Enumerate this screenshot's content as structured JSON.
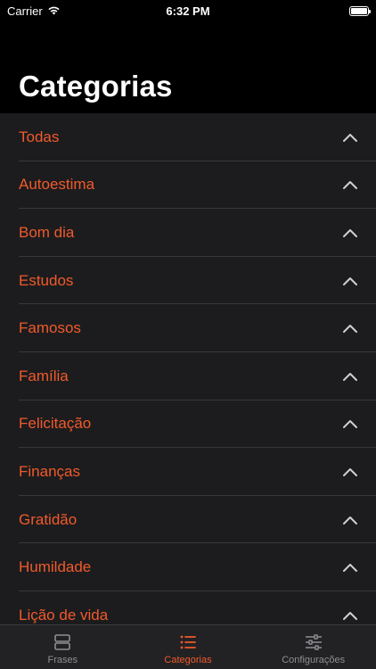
{
  "status": {
    "carrier": "Carrier",
    "time": "6:32 PM"
  },
  "page": {
    "title": "Categorias"
  },
  "categories": [
    {
      "label": "Todas"
    },
    {
      "label": "Autoestima"
    },
    {
      "label": "Bom dia"
    },
    {
      "label": "Estudos"
    },
    {
      "label": "Famosos"
    },
    {
      "label": "Família"
    },
    {
      "label": "Felicitação"
    },
    {
      "label": "Finanças"
    },
    {
      "label": "Gratidão"
    },
    {
      "label": "Humildade"
    },
    {
      "label": "Lição de vida"
    }
  ],
  "tabbar": {
    "tabs": [
      {
        "label": "Frases",
        "icon": "cards-icon",
        "active": false
      },
      {
        "label": "Categorias",
        "icon": "list-icon",
        "active": true
      },
      {
        "label": "Configurações",
        "icon": "sliders-icon",
        "active": false
      }
    ]
  },
  "colors": {
    "accent": "#f05a2b",
    "background": "#000000",
    "list_bg": "#1c1c1e",
    "separator": "#38383a",
    "inactive": "#8e8e93"
  }
}
